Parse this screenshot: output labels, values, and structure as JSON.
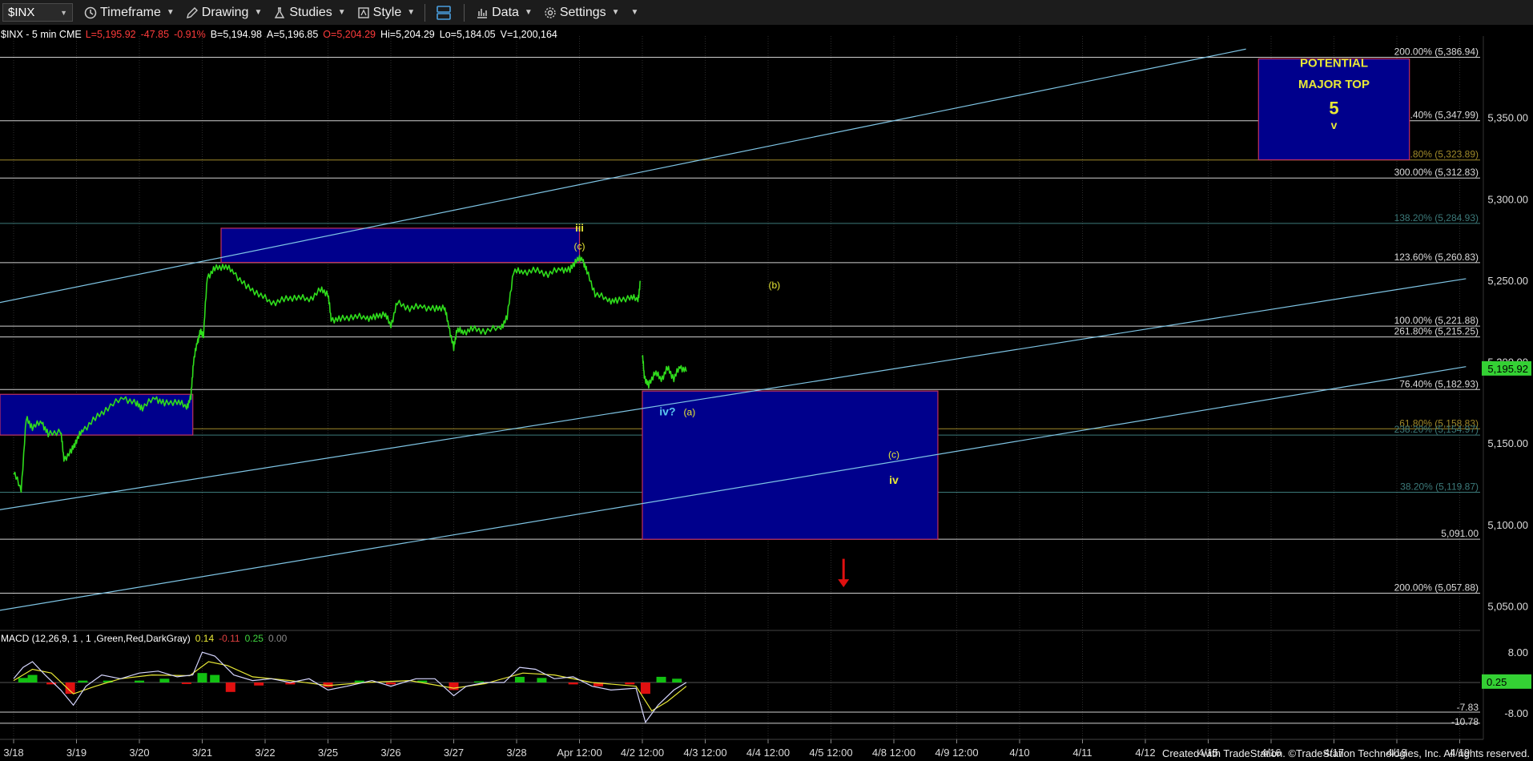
{
  "toolbar": {
    "symbol": "$INX",
    "items": [
      "Timeframe",
      "Drawing",
      "Studies",
      "Style",
      "",
      "Data",
      "Settings"
    ],
    "icons": [
      "clock-icon",
      "pencil-icon",
      "flask-icon",
      "style-icon",
      "layout-icon",
      "bar-chart-icon",
      "gear-icon"
    ]
  },
  "header": {
    "symbol_desc": "$INX - 5 min  CME",
    "last": "L=5,195.92",
    "net": "-47.85",
    "pct": "-0.91%",
    "bid": "B=5,194.98",
    "ask": "A=5,196.85",
    "open": "O=5,204.29",
    "high": "Hi=5,204.29",
    "low": "Lo=5,184.05",
    "volume": "V=1,200,164"
  },
  "colors": {
    "price": "#2fdc1c",
    "fib_line": "#c8d7e0",
    "channel": "#7fc5e5",
    "box_fill": "#00008c",
    "box_border": "#c03060",
    "wave_label": "#e8e836",
    "wave_label_blue": "#5bc8f0",
    "down_arrow": "#e01010",
    "macd_line": "#d6d6ff",
    "signal_line": "#e8e836",
    "hist_up": "#12c012",
    "hist_down": "#e01010",
    "current_price_bg": "#34d134"
  },
  "chart_data": {
    "type": "line",
    "timeframe": "5 min",
    "x_ticks": [
      "3/18",
      "3/19",
      "3/20",
      "3/21",
      "3/22",
      "3/25",
      "3/26",
      "3/27",
      "3/28",
      "Apr 12:00",
      "4/2 12:00",
      "4/3 12:00",
      "4/4 12:00",
      "4/5 12:00",
      "4/8 12:00",
      "4/9 12:00",
      "4/10",
      "4/11",
      "4/12",
      "4/15",
      "4/16",
      "4/17",
      "4/18",
      "4/19"
    ],
    "y_ticks": [
      "5,350.00",
      "5,300.00",
      "5,250.00",
      "5,200.00",
      "5,150.00",
      "5,100.00",
      "5,050.00"
    ],
    "ylim": [
      5036,
      5400
    ],
    "current_price": "5,195.92",
    "price_series": [
      {
        "x": 0.0,
        "y": 5133
      },
      {
        "x": 0.12,
        "y": 5121
      },
      {
        "x": 0.2,
        "y": 5165
      },
      {
        "x": 0.3,
        "y": 5160
      },
      {
        "x": 0.45,
        "y": 5163
      },
      {
        "x": 0.55,
        "y": 5155
      },
      {
        "x": 0.75,
        "y": 5158
      },
      {
        "x": 0.8,
        "y": 5140
      },
      {
        "x": 0.92,
        "y": 5145
      },
      {
        "x": 1.0,
        "y": 5152
      },
      {
        "x": 1.1,
        "y": 5158
      },
      {
        "x": 1.3,
        "y": 5165
      },
      {
        "x": 1.5,
        "y": 5172
      },
      {
        "x": 1.75,
        "y": 5178
      },
      {
        "x": 1.95,
        "y": 5174
      },
      {
        "x": 2.05,
        "y": 5172
      },
      {
        "x": 2.25,
        "y": 5178
      },
      {
        "x": 2.4,
        "y": 5174
      },
      {
        "x": 2.6,
        "y": 5176
      },
      {
        "x": 2.75,
        "y": 5172
      },
      {
        "x": 2.82,
        "y": 5178
      },
      {
        "x": 2.86,
        "y": 5200
      },
      {
        "x": 2.92,
        "y": 5212
      },
      {
        "x": 2.97,
        "y": 5218
      },
      {
        "x": 3.02,
        "y": 5217
      },
      {
        "x": 3.08,
        "y": 5252
      },
      {
        "x": 3.2,
        "y": 5257
      },
      {
        "x": 3.35,
        "y": 5259
      },
      {
        "x": 3.5,
        "y": 5255
      },
      {
        "x": 3.7,
        "y": 5246
      },
      {
        "x": 3.9,
        "y": 5242
      },
      {
        "x": 4.1,
        "y": 5236
      },
      {
        "x": 4.3,
        "y": 5238
      },
      {
        "x": 4.5,
        "y": 5240
      },
      {
        "x": 4.7,
        "y": 5238
      },
      {
        "x": 4.88,
        "y": 5244
      },
      {
        "x": 5.0,
        "y": 5242
      },
      {
        "x": 5.05,
        "y": 5226
      },
      {
        "x": 5.2,
        "y": 5226
      },
      {
        "x": 5.4,
        "y": 5228
      },
      {
        "x": 5.6,
        "y": 5227
      },
      {
        "x": 5.75,
        "y": 5227
      },
      {
        "x": 5.9,
        "y": 5230
      },
      {
        "x": 6.0,
        "y": 5222
      },
      {
        "x": 6.1,
        "y": 5236
      },
      {
        "x": 6.3,
        "y": 5233
      },
      {
        "x": 6.5,
        "y": 5234
      },
      {
        "x": 6.7,
        "y": 5232
      },
      {
        "x": 6.85,
        "y": 5234
      },
      {
        "x": 6.92,
        "y": 5222
      },
      {
        "x": 7.0,
        "y": 5208
      },
      {
        "x": 7.05,
        "y": 5220
      },
      {
        "x": 7.15,
        "y": 5218
      },
      {
        "x": 7.3,
        "y": 5220
      },
      {
        "x": 7.5,
        "y": 5219
      },
      {
        "x": 7.75,
        "y": 5221
      },
      {
        "x": 7.85,
        "y": 5227
      },
      {
        "x": 7.95,
        "y": 5256
      },
      {
        "x": 8.1,
        "y": 5255
      },
      {
        "x": 8.3,
        "y": 5256
      },
      {
        "x": 8.5,
        "y": 5254
      },
      {
        "x": 8.7,
        "y": 5257
      },
      {
        "x": 8.85,
        "y": 5256
      },
      {
        "x": 8.95,
        "y": 5263
      },
      {
        "x": 9.05,
        "y": 5263
      },
      {
        "x": 9.12,
        "y": 5255
      },
      {
        "x": 9.25,
        "y": 5242
      },
      {
        "x": 9.45,
        "y": 5238
      },
      {
        "x": 9.6,
        "y": 5237
      },
      {
        "x": 9.8,
        "y": 5240
      },
      {
        "x": 9.93,
        "y": 5238
      },
      {
        "x": 9.97,
        "y": 5249
      },
      null,
      {
        "x": 10.0,
        "y": 5205
      },
      {
        "x": 10.03,
        "y": 5191
      },
      {
        "x": 10.1,
        "y": 5185
      },
      {
        "x": 10.2,
        "y": 5194
      },
      {
        "x": 10.3,
        "y": 5189
      },
      {
        "x": 10.4,
        "y": 5196
      },
      {
        "x": 10.5,
        "y": 5190
      },
      {
        "x": 10.6,
        "y": 5197
      },
      {
        "x": 10.7,
        "y": 5194
      }
    ],
    "fib_levels": [
      {
        "label": "200.00% (5,386.94)",
        "value": 5386.94,
        "color": "#d0d0d0"
      },
      {
        "label": "176.40% (5,347.99)",
        "value": 5347.99,
        "color": "#d0d0d0"
      },
      {
        "label": "161.80% (5,323.89)",
        "value": 5323.89,
        "color": "#a08a2a"
      },
      {
        "label": "300.00% (5,312.83)",
        "value": 5312.83,
        "color": "#d0d0d0"
      },
      {
        "label": "138.20% (5,284.93)",
        "value": 5284.93,
        "color": "#3c7a7a"
      },
      {
        "label": "123.60% (5,260.83)",
        "value": 5260.83,
        "color": "#d0d0d0"
      },
      {
        "label": "100.00% (5,221.88)",
        "value": 5221.88,
        "color": "#d0d0d0"
      },
      {
        "label": "261.80% (5,215.25)",
        "value": 5215.25,
        "color": "#d0d0d0"
      },
      {
        "label": "76.40% (5,182.93)",
        "value": 5182.93,
        "color": "#d0d0d0"
      },
      {
        "label": "61.80% (5,158.83)",
        "value": 5158.83,
        "color": "#a08a2a"
      },
      {
        "label": "238.20% (5,154.97)",
        "value": 5154.97,
        "color": "#3c7a7a"
      },
      {
        "label": "38.20% (5,119.87)",
        "value": 5119.87,
        "color": "#3c7a7a"
      },
      {
        "label": "5,091.00",
        "value": 5091.0,
        "color": "#d0d0d0"
      },
      {
        "label": "200.00% (5,057.88)",
        "value": 5057.88,
        "color": "#d0d0d0"
      }
    ],
    "channel_lines": [
      {
        "x1": -0.9,
        "y1": 5231,
        "x2": 19.6,
        "y2": 5392
      },
      {
        "x1": -0.9,
        "y1": 5105,
        "x2": 23.1,
        "y2": 5251
      },
      {
        "x1": -0.9,
        "y1": 5043,
        "x2": 23.1,
        "y2": 5197
      }
    ],
    "boxes": [
      {
        "x1": -0.9,
        "x2": 2.85,
        "y_top": 5180,
        "y_bottom": 5155
      },
      {
        "x1": 3.3,
        "x2": 9.0,
        "y_top": 5282,
        "y_bottom": 5261
      },
      {
        "x1": 10.0,
        "x2": 14.7,
        "y_top": 5182,
        "y_bottom": 5091
      },
      {
        "x1": 19.8,
        "x2": 22.2,
        "y_top": 5386,
        "y_bottom": 5324
      }
    ],
    "annotations": [
      {
        "text": "iii",
        "x": 9.0,
        "y": 5280,
        "color": "yellow",
        "size": 13,
        "bold": true
      },
      {
        "text": "(c)",
        "x": 9.0,
        "y": 5269,
        "color": "yellow",
        "size": 12
      },
      {
        "text": "(b)",
        "x": 12.1,
        "y": 5245,
        "color": "yellow",
        "size": 12
      },
      {
        "text": "iv?",
        "x": 10.4,
        "y": 5167,
        "color": "blue",
        "size": 14,
        "bold": true
      },
      {
        "text": "(a)",
        "x": 10.75,
        "y": 5167,
        "color": "yellow",
        "size": 12
      },
      {
        "text": "(c)",
        "x": 14.0,
        "y": 5141,
        "color": "yellow",
        "size": 12
      },
      {
        "text": "iv",
        "x": 14.0,
        "y": 5125,
        "color": "yellow",
        "size": 14,
        "bold": true
      },
      {
        "text": "POTENTIAL",
        "x": 21.0,
        "y": 5381,
        "color": "yellow",
        "size": 15,
        "bold": true
      },
      {
        "text": "MAJOR TOP",
        "x": 21.0,
        "y": 5368,
        "color": "yellow",
        "size": 15,
        "bold": true
      },
      {
        "text": "5",
        "x": 21.0,
        "y": 5352,
        "color": "yellow",
        "size": 22,
        "bold": true
      },
      {
        "text": "v",
        "x": 21.0,
        "y": 5343,
        "color": "yellow",
        "size": 14,
        "bold": true
      }
    ],
    "down_arrow": {
      "x": 13.2,
      "y_top": 5079,
      "y_bottom": 5062
    },
    "macd": {
      "label": "MACD (12,26,9, 1 , 1 ,Green,Red,DarkGray)",
      "values": [
        "0.14",
        "-0.11",
        "0.25",
        "0.00"
      ],
      "y_ticks": [
        "8.00",
        "-8.00"
      ],
      "ylim": [
        -12.5,
        12.5
      ],
      "current": "0.25",
      "min_labels": [
        "-7.83",
        "-10.78"
      ],
      "macd_series": [
        {
          "x": 0.0,
          "y": 1
        },
        {
          "x": 0.15,
          "y": 4
        },
        {
          "x": 0.3,
          "y": 5.5
        },
        {
          "x": 0.5,
          "y": 2
        },
        {
          "x": 0.75,
          "y": -2
        },
        {
          "x": 0.95,
          "y": -6
        },
        {
          "x": 1.15,
          "y": -1
        },
        {
          "x": 1.4,
          "y": 2
        },
        {
          "x": 1.7,
          "y": 1
        },
        {
          "x": 2.0,
          "y": 2.5
        },
        {
          "x": 2.3,
          "y": 3
        },
        {
          "x": 2.6,
          "y": 1.5
        },
        {
          "x": 2.85,
          "y": 2
        },
        {
          "x": 3.0,
          "y": 8
        },
        {
          "x": 3.2,
          "y": 7
        },
        {
          "x": 3.5,
          "y": 2
        },
        {
          "x": 3.8,
          "y": 0.5
        },
        {
          "x": 4.1,
          "y": 1
        },
        {
          "x": 4.4,
          "y": 0
        },
        {
          "x": 4.7,
          "y": 1
        },
        {
          "x": 5.0,
          "y": -2
        },
        {
          "x": 5.3,
          "y": -1
        },
        {
          "x": 5.7,
          "y": 0.5
        },
        {
          "x": 6.0,
          "y": -1
        },
        {
          "x": 6.4,
          "y": 1
        },
        {
          "x": 6.7,
          "y": 1
        },
        {
          "x": 7.0,
          "y": -3.5
        },
        {
          "x": 7.2,
          "y": -1
        },
        {
          "x": 7.5,
          "y": 0
        },
        {
          "x": 7.8,
          "y": 0
        },
        {
          "x": 8.05,
          "y": 4
        },
        {
          "x": 8.3,
          "y": 3.5
        },
        {
          "x": 8.6,
          "y": 1
        },
        {
          "x": 8.9,
          "y": 1.5
        },
        {
          "x": 9.2,
          "y": -1
        },
        {
          "x": 9.5,
          "y": -2
        },
        {
          "x": 9.9,
          "y": -1.5
        },
        {
          "x": 10.05,
          "y": -10.5
        },
        {
          "x": 10.25,
          "y": -6
        },
        {
          "x": 10.5,
          "y": -2
        },
        {
          "x": 10.7,
          "y": 0
        }
      ],
      "signal_series": [
        {
          "x": 0.0,
          "y": 0.5
        },
        {
          "x": 0.3,
          "y": 3.5
        },
        {
          "x": 0.6,
          "y": 2.5
        },
        {
          "x": 0.95,
          "y": -3
        },
        {
          "x": 1.3,
          "y": -1
        },
        {
          "x": 1.7,
          "y": 1
        },
        {
          "x": 2.2,
          "y": 2
        },
        {
          "x": 2.8,
          "y": 1.8
        },
        {
          "x": 3.1,
          "y": 5.5
        },
        {
          "x": 3.4,
          "y": 4.5
        },
        {
          "x": 3.8,
          "y": 1.5
        },
        {
          "x": 4.4,
          "y": 0.5
        },
        {
          "x": 5.0,
          "y": -0.8
        },
        {
          "x": 5.6,
          "y": 0
        },
        {
          "x": 6.3,
          "y": 0.5
        },
        {
          "x": 7.0,
          "y": -1.5
        },
        {
          "x": 7.5,
          "y": -0.3
        },
        {
          "x": 8.1,
          "y": 2.5
        },
        {
          "x": 8.6,
          "y": 2
        },
        {
          "x": 9.2,
          "y": 0
        },
        {
          "x": 9.9,
          "y": -1
        },
        {
          "x": 10.15,
          "y": -7.5
        },
        {
          "x": 10.4,
          "y": -5
        },
        {
          "x": 10.7,
          "y": -1
        }
      ],
      "histogram": [
        {
          "x": 0.15,
          "y": 1.2
        },
        {
          "x": 0.3,
          "y": 2
        },
        {
          "x": 0.6,
          "y": -0.5
        },
        {
          "x": 0.9,
          "y": -3
        },
        {
          "x": 1.1,
          "y": 0.5
        },
        {
          "x": 1.5,
          "y": 0.5
        },
        {
          "x": 2.0,
          "y": 0.5
        },
        {
          "x": 2.4,
          "y": 1
        },
        {
          "x": 2.75,
          "y": -0.4
        },
        {
          "x": 3.0,
          "y": 2.5
        },
        {
          "x": 3.2,
          "y": 2
        },
        {
          "x": 3.45,
          "y": -2.5
        },
        {
          "x": 3.9,
          "y": -0.8
        },
        {
          "x": 4.4,
          "y": -0.5
        },
        {
          "x": 5.0,
          "y": -1.2
        },
        {
          "x": 5.5,
          "y": 0.5
        },
        {
          "x": 6.0,
          "y": -0.5
        },
        {
          "x": 6.5,
          "y": 0.5
        },
        {
          "x": 7.0,
          "y": -2
        },
        {
          "x": 7.4,
          "y": 0.3
        },
        {
          "x": 8.05,
          "y": 1.5
        },
        {
          "x": 8.4,
          "y": 1.2
        },
        {
          "x": 8.9,
          "y": -0.5
        },
        {
          "x": 9.3,
          "y": -1
        },
        {
          "x": 9.8,
          "y": -0.5
        },
        {
          "x": 10.05,
          "y": -3
        },
        {
          "x": 10.3,
          "y": 1.5
        },
        {
          "x": 10.55,
          "y": 1
        }
      ]
    }
  },
  "footer": {
    "credit": "Created with TradeStation. ©TradeStation Technologies, Inc. All rights reserved."
  }
}
